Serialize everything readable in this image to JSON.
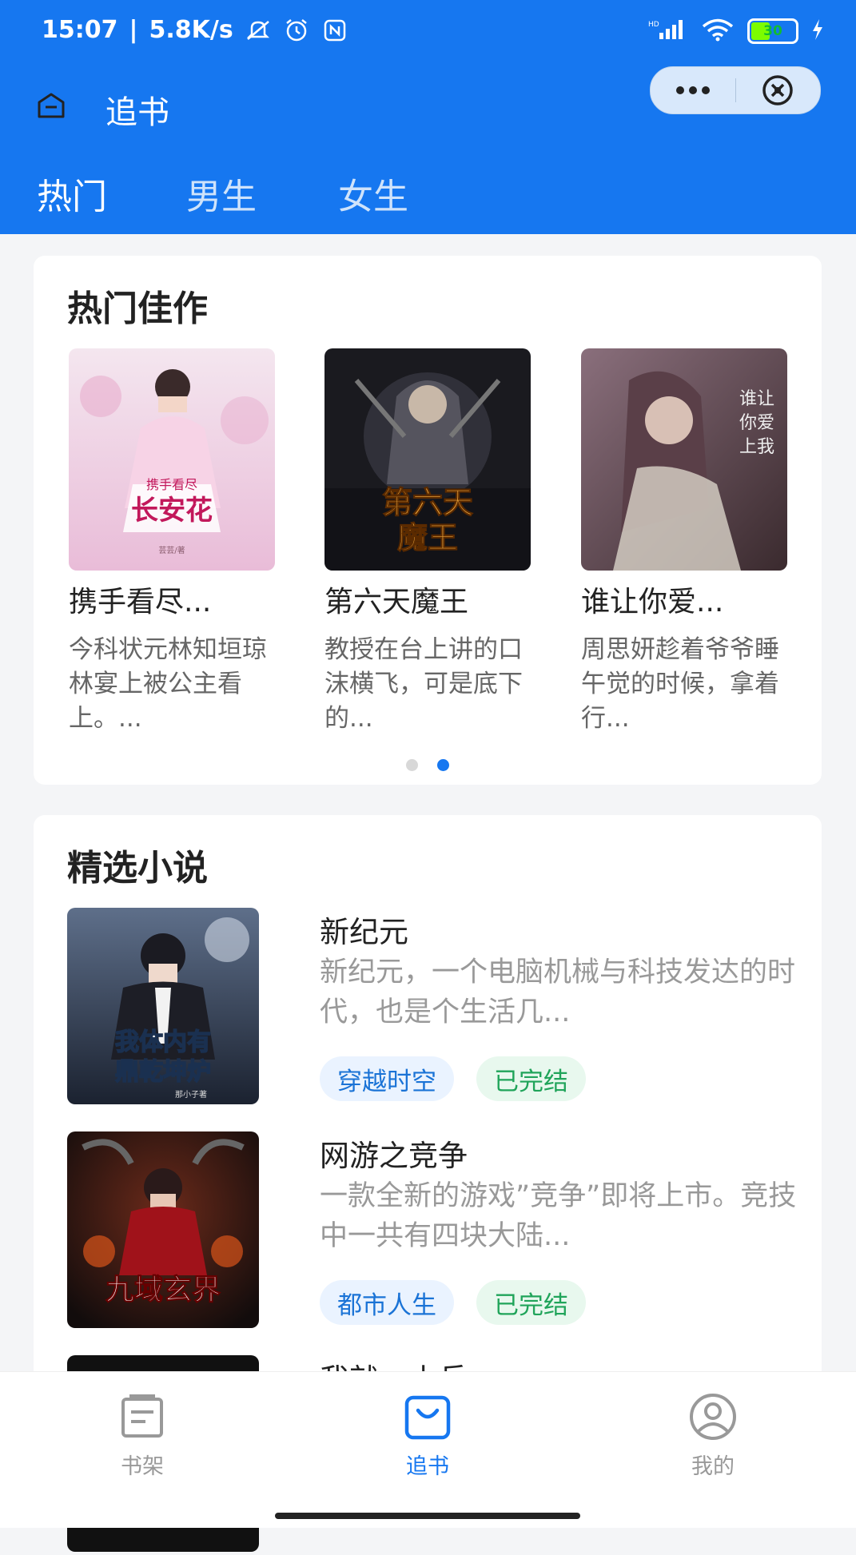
{
  "status": {
    "time": "15:07",
    "speed": "5.8K/s",
    "battery": "30"
  },
  "nav": {
    "title": "追书"
  },
  "tabs": [
    {
      "label": "热门",
      "active": true
    },
    {
      "label": "男生",
      "active": false
    },
    {
      "label": "女生",
      "active": false
    }
  ],
  "hot": {
    "title": "热门佳作",
    "books": [
      {
        "title": "携手看尽...",
        "desc": "今科状元林知垣琼林宴上被公主看上。...",
        "cover_text": "携手看尽长安花",
        "cover_author": "芸芸/著"
      },
      {
        "title": "第六天魔王",
        "desc": "教授在台上讲的口沫横飞，可是底下的...",
        "cover_text": "第六天魔王"
      },
      {
        "title": "谁让你爱...",
        "desc": "周思妍趁着爷爷睡午觉的时候，拿着行..."
      }
    ],
    "pager": {
      "count": 2,
      "active": 1
    }
  },
  "selected": {
    "title": "精选小说",
    "books": [
      {
        "title": "新纪元",
        "desc": "新纪元，一个电脑机械与科技发达的时代，也是个生活几...",
        "tags": [
          "穿越时空",
          "已完结"
        ],
        "cover_text": "我体内有鼎乾坤炉",
        "cover_author": "那小子著"
      },
      {
        "title": "网游之竞争",
        "desc": "一款全新的游戏”竞争”即将上市。竞技中一共有四块大陆...",
        "tags": [
          "都市人生",
          "已完结"
        ],
        "cover_text": "九域玄界"
      },
      {
        "title": "我就一小兵",
        "desc": "",
        "tags": []
      }
    ]
  },
  "bottom_nav": [
    {
      "label": "书架",
      "icon": "bookshelf-icon",
      "active": false
    },
    {
      "label": "追书",
      "icon": "bag-icon",
      "active": true
    },
    {
      "label": "我的",
      "icon": "profile-icon",
      "active": false
    }
  ],
  "colors": {
    "primary": "#1677f0",
    "tag_blue": "#1a73d6",
    "tag_green": "#20a45a"
  }
}
